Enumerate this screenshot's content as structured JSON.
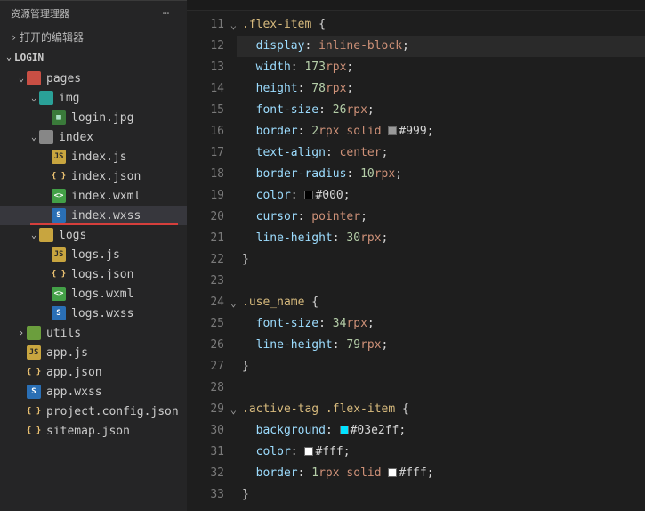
{
  "sidebar": {
    "title": "资源管理理器",
    "open_editors_label": "打开的编辑器",
    "project_name": "LOGIN",
    "tree": [
      {
        "kind": "folder",
        "label": "pages",
        "depth": 0,
        "expanded": true,
        "iconClass": "icon-folder-red"
      },
      {
        "kind": "folder",
        "label": "img",
        "depth": 1,
        "expanded": true,
        "iconClass": "icon-folder-teal"
      },
      {
        "kind": "file",
        "label": "login.jpg",
        "depth": 2,
        "iconClass": "icon-img",
        "iconText": "▦"
      },
      {
        "kind": "folder",
        "label": "index",
        "depth": 1,
        "expanded": true,
        "iconClass": "icon-folder-grey"
      },
      {
        "kind": "file",
        "label": "index.js",
        "depth": 2,
        "iconClass": "icon-js",
        "iconText": "JS"
      },
      {
        "kind": "file",
        "label": "index.json",
        "depth": 2,
        "iconClass": "icon-json",
        "iconText": "{ }"
      },
      {
        "kind": "file",
        "label": "index.wxml",
        "depth": 2,
        "iconClass": "icon-xml",
        "iconText": "<>"
      },
      {
        "kind": "file",
        "label": "index.wxss",
        "depth": 2,
        "iconClass": "icon-wxss",
        "iconText": "S",
        "selected": true
      },
      {
        "kind": "folder",
        "label": "logs",
        "depth": 1,
        "expanded": true,
        "iconClass": "icon-folder-yellow"
      },
      {
        "kind": "file",
        "label": "logs.js",
        "depth": 2,
        "iconClass": "icon-js",
        "iconText": "JS"
      },
      {
        "kind": "file",
        "label": "logs.json",
        "depth": 2,
        "iconClass": "icon-json",
        "iconText": "{ }"
      },
      {
        "kind": "file",
        "label": "logs.wxml",
        "depth": 2,
        "iconClass": "icon-xml",
        "iconText": "<>"
      },
      {
        "kind": "file",
        "label": "logs.wxss",
        "depth": 2,
        "iconClass": "icon-wxss",
        "iconText": "S"
      },
      {
        "kind": "folder",
        "label": "utils",
        "depth": 0,
        "expanded": false,
        "iconClass": "icon-folder-green"
      },
      {
        "kind": "file",
        "label": "app.js",
        "depth": 0,
        "iconClass": "icon-js",
        "iconText": "JS"
      },
      {
        "kind": "file",
        "label": "app.json",
        "depth": 0,
        "iconClass": "icon-json",
        "iconText": "{ }"
      },
      {
        "kind": "file",
        "label": "app.wxss",
        "depth": 0,
        "iconClass": "icon-wxss",
        "iconText": "S"
      },
      {
        "kind": "file",
        "label": "project.config.json",
        "depth": 0,
        "iconClass": "icon-json",
        "iconText": "{ }"
      },
      {
        "kind": "file",
        "label": "sitemap.json",
        "depth": 0,
        "iconClass": "icon-json",
        "iconText": "{ }"
      }
    ]
  },
  "editor": {
    "first_line_number": 11,
    "highlighted_line": 12,
    "fold_lines": [
      11,
      24,
      29
    ],
    "code": [
      [
        [
          "sel",
          ".flex-item "
        ],
        [
          "punc",
          "{"
        ]
      ],
      [
        [
          "prop",
          "display"
        ],
        [
          "punc",
          ": "
        ],
        [
          "val",
          "inline-block"
        ],
        [
          "punc",
          ";"
        ]
      ],
      [
        [
          "prop",
          "width"
        ],
        [
          "punc",
          ": "
        ],
        [
          "num",
          "173"
        ],
        [
          "unit",
          "rpx"
        ],
        [
          "punc",
          ";"
        ]
      ],
      [
        [
          "prop",
          "height"
        ],
        [
          "punc",
          ": "
        ],
        [
          "num",
          "78"
        ],
        [
          "unit",
          "rpx"
        ],
        [
          "punc",
          ";"
        ]
      ],
      [
        [
          "prop",
          "font-size"
        ],
        [
          "punc",
          ": "
        ],
        [
          "num",
          "26"
        ],
        [
          "unit",
          "rpx"
        ],
        [
          "punc",
          ";"
        ]
      ],
      [
        [
          "prop",
          "border"
        ],
        [
          "punc",
          ": "
        ],
        [
          "num",
          "2"
        ],
        [
          "unit",
          "rpx "
        ],
        [
          "kw",
          "solid "
        ],
        [
          "swatch",
          "#999999"
        ],
        [
          "hex",
          "#999"
        ],
        [
          "punc",
          ";"
        ]
      ],
      [
        [
          "prop",
          "text-align"
        ],
        [
          "punc",
          ": "
        ],
        [
          "val",
          "center"
        ],
        [
          "punc",
          ";"
        ]
      ],
      [
        [
          "prop",
          "border-radius"
        ],
        [
          "punc",
          ": "
        ],
        [
          "num",
          "10"
        ],
        [
          "unit",
          "rpx"
        ],
        [
          "punc",
          ";"
        ]
      ],
      [
        [
          "prop",
          "color"
        ],
        [
          "punc",
          ": "
        ],
        [
          "swatch",
          "#000000"
        ],
        [
          "hex",
          "#000"
        ],
        [
          "punc",
          ";"
        ]
      ],
      [
        [
          "prop",
          "cursor"
        ],
        [
          "punc",
          ": "
        ],
        [
          "val",
          "pointer"
        ],
        [
          "punc",
          ";"
        ]
      ],
      [
        [
          "prop",
          "line-height"
        ],
        [
          "punc",
          ": "
        ],
        [
          "num",
          "30"
        ],
        [
          "unit",
          "rpx"
        ],
        [
          "punc",
          ";"
        ]
      ],
      [
        [
          "punc",
          "}"
        ]
      ],
      [],
      [
        [
          "sel",
          ".use_name "
        ],
        [
          "punc",
          "{"
        ]
      ],
      [
        [
          "prop",
          "font-size"
        ],
        [
          "punc",
          ": "
        ],
        [
          "num",
          "34"
        ],
        [
          "unit",
          "rpx"
        ],
        [
          "punc",
          ";"
        ]
      ],
      [
        [
          "prop",
          "line-height"
        ],
        [
          "punc",
          ": "
        ],
        [
          "num",
          "79"
        ],
        [
          "unit",
          "rpx"
        ],
        [
          "punc",
          ";"
        ]
      ],
      [
        [
          "punc",
          "}"
        ]
      ],
      [],
      [
        [
          "sel",
          ".active-tag .flex-item "
        ],
        [
          "punc",
          "{"
        ]
      ],
      [
        [
          "prop",
          "background"
        ],
        [
          "punc",
          ": "
        ],
        [
          "swatch",
          "#03e2ff"
        ],
        [
          "hex",
          "#03e2ff"
        ],
        [
          "punc",
          ";"
        ]
      ],
      [
        [
          "prop",
          "color"
        ],
        [
          "punc",
          ": "
        ],
        [
          "swatch",
          "#ffffff"
        ],
        [
          "hex",
          "#fff"
        ],
        [
          "punc",
          ";"
        ]
      ],
      [
        [
          "prop",
          "border"
        ],
        [
          "punc",
          ": "
        ],
        [
          "num",
          "1"
        ],
        [
          "unit",
          "rpx "
        ],
        [
          "kw",
          "solid "
        ],
        [
          "swatch",
          "#ffffff"
        ],
        [
          "hex",
          "#fff"
        ],
        [
          "punc",
          ";"
        ]
      ],
      [
        [
          "punc",
          "}"
        ]
      ]
    ]
  }
}
